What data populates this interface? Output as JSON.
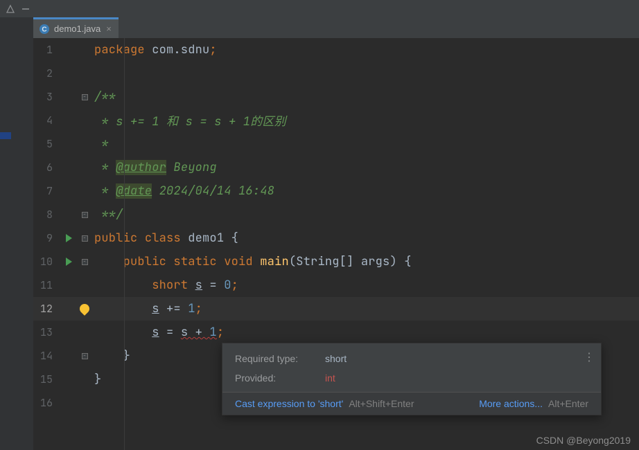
{
  "window": {
    "file_name": "demo1.java"
  },
  "gutter": {
    "lines": [
      "1",
      "2",
      "3",
      "4",
      "5",
      "6",
      "7",
      "8",
      "9",
      "10",
      "11",
      "12",
      "13",
      "14",
      "15",
      "16"
    ],
    "current_line_index": 11
  },
  "code": {
    "l1_kw": "package",
    "l1_pkg": " com.sdnu",
    "l1_semi": ";",
    "l3_doc": "/**",
    "l4_doc": " * s += 1 和 s = s + 1的区别",
    "l5_doc": " *",
    "l6_pre": " * ",
    "l6_tag": "@author",
    "l6_rest": " Beyong",
    "l7_pre": " * ",
    "l7_tag": "@date",
    "l7_rest": " 2024/04/14 16:48",
    "l8_doc": " **/",
    "l9_kw1": "public",
    "l9_kw2": "class",
    "l9_name": "demo1",
    "l9_brace": " {",
    "l10_kw1": "public",
    "l10_kw2": "static",
    "l10_kw3": "void",
    "l10_fn": "main",
    "l10_sig": "(String[] args) {",
    "l11_kw": "short",
    "l11_var": "s",
    "l11_eq": " = ",
    "l11_num": "0",
    "l11_semi": ";",
    "l12_var": "s",
    "l12_op": " += ",
    "l12_num": "1",
    "l12_semi": ";",
    "l13_var1": "s",
    "l13_eq": " = ",
    "l13_expr_a": "s + ",
    "l13_expr_b": "1",
    "l13_semi": ";",
    "l14_close": "}",
    "l15_close": "}"
  },
  "popup": {
    "required_label": "Required type:",
    "required_value": "short",
    "provided_label": "Provided:",
    "provided_value": "int",
    "fix_label": "Cast expression to 'short'",
    "fix_shortcut": "Alt+Shift+Enter",
    "more_label": "More actions...",
    "more_shortcut": "Alt+Enter"
  },
  "watermark": "CSDN @Beyong2019"
}
